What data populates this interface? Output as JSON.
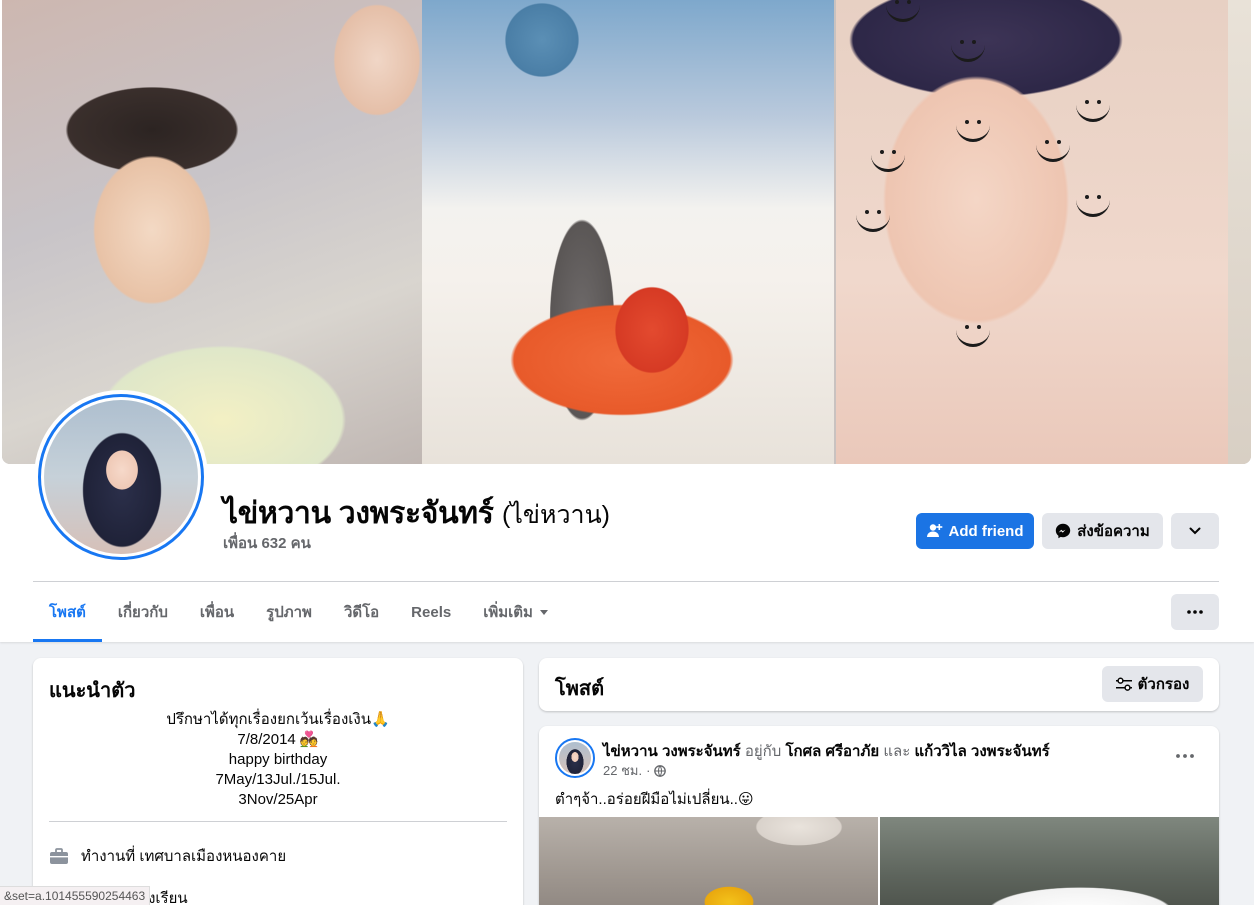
{
  "profile": {
    "name": "ไข่หวาน วงพระจันทร์",
    "alt_name": "(ไข่หวาน)",
    "friends": "เพื่อน 632 คน"
  },
  "actions": {
    "add_friend": "Add friend",
    "message": "ส่งข้อความ"
  },
  "tabs": [
    {
      "label": "โพสต์",
      "active": true
    },
    {
      "label": "เกี่ยวกับ"
    },
    {
      "label": "เพื่อน"
    },
    {
      "label": "รูปภาพ"
    },
    {
      "label": "วิดีโอ"
    },
    {
      "label": "Reels"
    },
    {
      "label": "เพิ่มเติม"
    }
  ],
  "intro": {
    "title": "แนะนำตัว",
    "bio": [
      "ปรึกษาได้ทุกเรื่องยกเว้นเรื่องเงิน🙏",
      "7/8/2014 💑",
      "happy birthday",
      "7May/13Jul./15Jul.",
      "3Nov/25Apr"
    ],
    "work": "ทำงานที่ เทศบาลเมืองหนองคาย",
    "school": "ศึกษาที่ โรงเรียน"
  },
  "status_url": "&set=a.101455590254463",
  "posts_section": {
    "title": "โพสต์",
    "filter_label": "ตัวกรอง"
  },
  "post": {
    "author": "ไข่หวาน วงพระจันทร์",
    "with_text": "อยู่กับ",
    "tagged_1": "โกศล ศรีอาภัย",
    "and_text": "และ",
    "tagged_2": "แก้ววิไล วงพระจันทร์",
    "time": "22 ชม.",
    "text": "ตำๆจ้า..อร่อยฝีมือไม่เปลี่ยน..😛"
  },
  "colors": {
    "accent": "#1877f2",
    "background": "#f0f2f5",
    "secondary_button": "#e4e6eb",
    "muted_text": "#65676b"
  }
}
